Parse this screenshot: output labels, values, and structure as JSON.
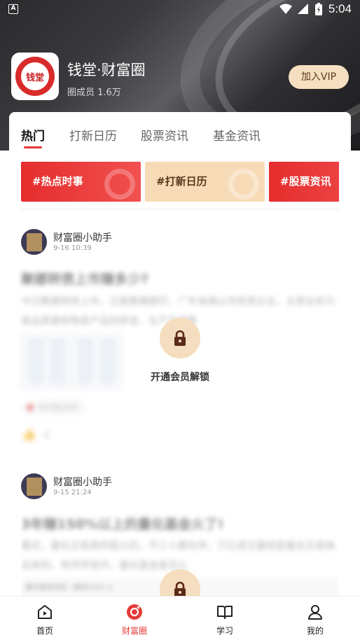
{
  "status_bar": {
    "time": "5:04",
    "left_icon": "A"
  },
  "circle": {
    "logo_text": "钱堂",
    "name": "钱堂·财富圈",
    "members": "圈成员 1.6万",
    "join_vip_label": "加入VIP"
  },
  "tabs": [
    {
      "label": "热门",
      "active": true
    },
    {
      "label": "打新日历",
      "active": false
    },
    {
      "label": "股票资讯",
      "active": false
    },
    {
      "label": "基金资讯",
      "active": false
    }
  ],
  "topics": [
    {
      "label": "#热点时事",
      "style": "red"
    },
    {
      "label": "#打新日历",
      "style": "tan"
    },
    {
      "label": "#股票资讯",
      "style": "red"
    }
  ],
  "posts": [
    {
      "author": "财富圈小助手",
      "time": "9-16 10:39",
      "title": "聚娜转债上市赚多少?",
      "body": "今日聚娜转债上市。正股聚娜朗莎，广东省佛山市民营企业，主营业务为高品质建筑陶瓷产品的研发、生产及销售",
      "tag": "#打新日历",
      "likes": "0",
      "unlock_label": "开通会员解锁"
    },
    {
      "author": "财富圈小助手",
      "time": "9-15 21:24",
      "title": "3年赚150%以上的量化基金火了!",
      "body": "最近，量化交易真的挺火的，不少人都在传，万亿成交量就是量化交易搞出来的。有同学就问，量化基金是怎么",
      "thumb_caption": "量化基金排名（截至2021.9"
    }
  ],
  "bottom_nav": [
    {
      "label": "首页",
      "icon": "home-icon",
      "active": false
    },
    {
      "label": "财富圈",
      "icon": "wealth-circle-icon",
      "active": true
    },
    {
      "label": "学习",
      "icon": "book-icon",
      "active": false
    },
    {
      "label": "我的",
      "icon": "profile-icon",
      "active": false
    }
  ],
  "colors": {
    "accent": "#e43a36",
    "vip_bg": "#f6dfc0",
    "topic_tan": "#f7dbb6"
  }
}
